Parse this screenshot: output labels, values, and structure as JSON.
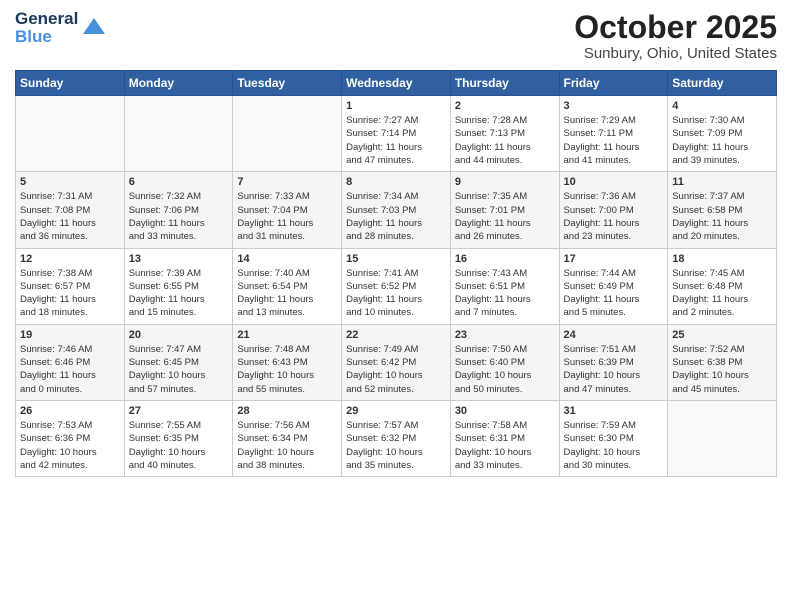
{
  "header": {
    "logo_line1": "General",
    "logo_line2": "Blue",
    "month": "October 2025",
    "location": "Sunbury, Ohio, United States"
  },
  "weekdays": [
    "Sunday",
    "Monday",
    "Tuesday",
    "Wednesday",
    "Thursday",
    "Friday",
    "Saturday"
  ],
  "weeks": [
    [
      {
        "day": "",
        "info": ""
      },
      {
        "day": "",
        "info": ""
      },
      {
        "day": "",
        "info": ""
      },
      {
        "day": "1",
        "info": "Sunrise: 7:27 AM\nSunset: 7:14 PM\nDaylight: 11 hours\nand 47 minutes."
      },
      {
        "day": "2",
        "info": "Sunrise: 7:28 AM\nSunset: 7:13 PM\nDaylight: 11 hours\nand 44 minutes."
      },
      {
        "day": "3",
        "info": "Sunrise: 7:29 AM\nSunset: 7:11 PM\nDaylight: 11 hours\nand 41 minutes."
      },
      {
        "day": "4",
        "info": "Sunrise: 7:30 AM\nSunset: 7:09 PM\nDaylight: 11 hours\nand 39 minutes."
      }
    ],
    [
      {
        "day": "5",
        "info": "Sunrise: 7:31 AM\nSunset: 7:08 PM\nDaylight: 11 hours\nand 36 minutes."
      },
      {
        "day": "6",
        "info": "Sunrise: 7:32 AM\nSunset: 7:06 PM\nDaylight: 11 hours\nand 33 minutes."
      },
      {
        "day": "7",
        "info": "Sunrise: 7:33 AM\nSunset: 7:04 PM\nDaylight: 11 hours\nand 31 minutes."
      },
      {
        "day": "8",
        "info": "Sunrise: 7:34 AM\nSunset: 7:03 PM\nDaylight: 11 hours\nand 28 minutes."
      },
      {
        "day": "9",
        "info": "Sunrise: 7:35 AM\nSunset: 7:01 PM\nDaylight: 11 hours\nand 26 minutes."
      },
      {
        "day": "10",
        "info": "Sunrise: 7:36 AM\nSunset: 7:00 PM\nDaylight: 11 hours\nand 23 minutes."
      },
      {
        "day": "11",
        "info": "Sunrise: 7:37 AM\nSunset: 6:58 PM\nDaylight: 11 hours\nand 20 minutes."
      }
    ],
    [
      {
        "day": "12",
        "info": "Sunrise: 7:38 AM\nSunset: 6:57 PM\nDaylight: 11 hours\nand 18 minutes."
      },
      {
        "day": "13",
        "info": "Sunrise: 7:39 AM\nSunset: 6:55 PM\nDaylight: 11 hours\nand 15 minutes."
      },
      {
        "day": "14",
        "info": "Sunrise: 7:40 AM\nSunset: 6:54 PM\nDaylight: 11 hours\nand 13 minutes."
      },
      {
        "day": "15",
        "info": "Sunrise: 7:41 AM\nSunset: 6:52 PM\nDaylight: 11 hours\nand 10 minutes."
      },
      {
        "day": "16",
        "info": "Sunrise: 7:43 AM\nSunset: 6:51 PM\nDaylight: 11 hours\nand 7 minutes."
      },
      {
        "day": "17",
        "info": "Sunrise: 7:44 AM\nSunset: 6:49 PM\nDaylight: 11 hours\nand 5 minutes."
      },
      {
        "day": "18",
        "info": "Sunrise: 7:45 AM\nSunset: 6:48 PM\nDaylight: 11 hours\nand 2 minutes."
      }
    ],
    [
      {
        "day": "19",
        "info": "Sunrise: 7:46 AM\nSunset: 6:46 PM\nDaylight: 11 hours\nand 0 minutes."
      },
      {
        "day": "20",
        "info": "Sunrise: 7:47 AM\nSunset: 6:45 PM\nDaylight: 10 hours\nand 57 minutes."
      },
      {
        "day": "21",
        "info": "Sunrise: 7:48 AM\nSunset: 6:43 PM\nDaylight: 10 hours\nand 55 minutes."
      },
      {
        "day": "22",
        "info": "Sunrise: 7:49 AM\nSunset: 6:42 PM\nDaylight: 10 hours\nand 52 minutes."
      },
      {
        "day": "23",
        "info": "Sunrise: 7:50 AM\nSunset: 6:40 PM\nDaylight: 10 hours\nand 50 minutes."
      },
      {
        "day": "24",
        "info": "Sunrise: 7:51 AM\nSunset: 6:39 PM\nDaylight: 10 hours\nand 47 minutes."
      },
      {
        "day": "25",
        "info": "Sunrise: 7:52 AM\nSunset: 6:38 PM\nDaylight: 10 hours\nand 45 minutes."
      }
    ],
    [
      {
        "day": "26",
        "info": "Sunrise: 7:53 AM\nSunset: 6:36 PM\nDaylight: 10 hours\nand 42 minutes."
      },
      {
        "day": "27",
        "info": "Sunrise: 7:55 AM\nSunset: 6:35 PM\nDaylight: 10 hours\nand 40 minutes."
      },
      {
        "day": "28",
        "info": "Sunrise: 7:56 AM\nSunset: 6:34 PM\nDaylight: 10 hours\nand 38 minutes."
      },
      {
        "day": "29",
        "info": "Sunrise: 7:57 AM\nSunset: 6:32 PM\nDaylight: 10 hours\nand 35 minutes."
      },
      {
        "day": "30",
        "info": "Sunrise: 7:58 AM\nSunset: 6:31 PM\nDaylight: 10 hours\nand 33 minutes."
      },
      {
        "day": "31",
        "info": "Sunrise: 7:59 AM\nSunset: 6:30 PM\nDaylight: 10 hours\nand 30 minutes."
      },
      {
        "day": "",
        "info": ""
      }
    ]
  ]
}
